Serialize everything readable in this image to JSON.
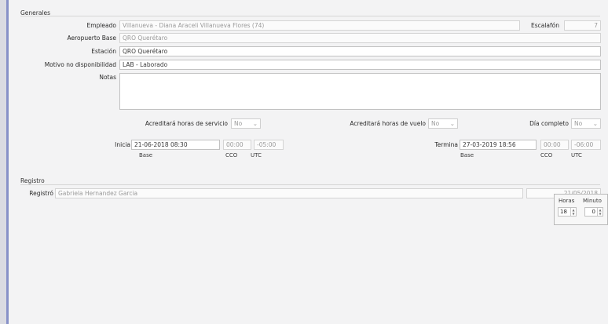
{
  "generales": {
    "title": "Generales",
    "empleado_label": "Empleado",
    "empleado_value": "Villanueva - Diana Araceli Villanueva Flores (74)",
    "escalafon_label": "Escalafón",
    "escalafon_value": "7",
    "aeropuerto_label": "Aeropuerto Base",
    "aeropuerto_value": "QRO Querétaro",
    "estacion_label": "Estación",
    "estacion_value": "QRO Querétaro",
    "motivo_label": "Motivo no disponibilidad",
    "motivo_value": "LAB - Laborado",
    "notas_label": "Notas",
    "notas_value": "",
    "acred_servicio_label": "Acreditará horas de servicio",
    "acred_servicio_value": "No",
    "acred_vuelo_label": "Acreditará horas de vuelo",
    "acred_vuelo_value": "No",
    "dia_completo_label": "Día completo",
    "dia_completo_value": "No",
    "inicio_label": "Inicia",
    "inicio_base": "21-06-2018 08:30",
    "inicio_cco": "00:00",
    "inicio_utc": "-05:00",
    "termina_label": "Termina",
    "termina_base": "27-03-2019 18:56",
    "termina_cco": "00:00",
    "termina_utc": "-06:00",
    "sub_base": "Base",
    "sub_cco": "CCO",
    "sub_utc": "UTC"
  },
  "registro": {
    "title": "Registro",
    "registro_label": "Registró",
    "registro_value": "Gabriela Hernandez Garcia",
    "registro_date": "21/05/2018",
    "horas_label": "Horas",
    "minutos_label": "Minuto",
    "horas_value": "18",
    "minutos_value": "0"
  },
  "icons": {
    "dropdown": "chevron-down-icon",
    "spinner": "spinner-arrows-icon"
  }
}
